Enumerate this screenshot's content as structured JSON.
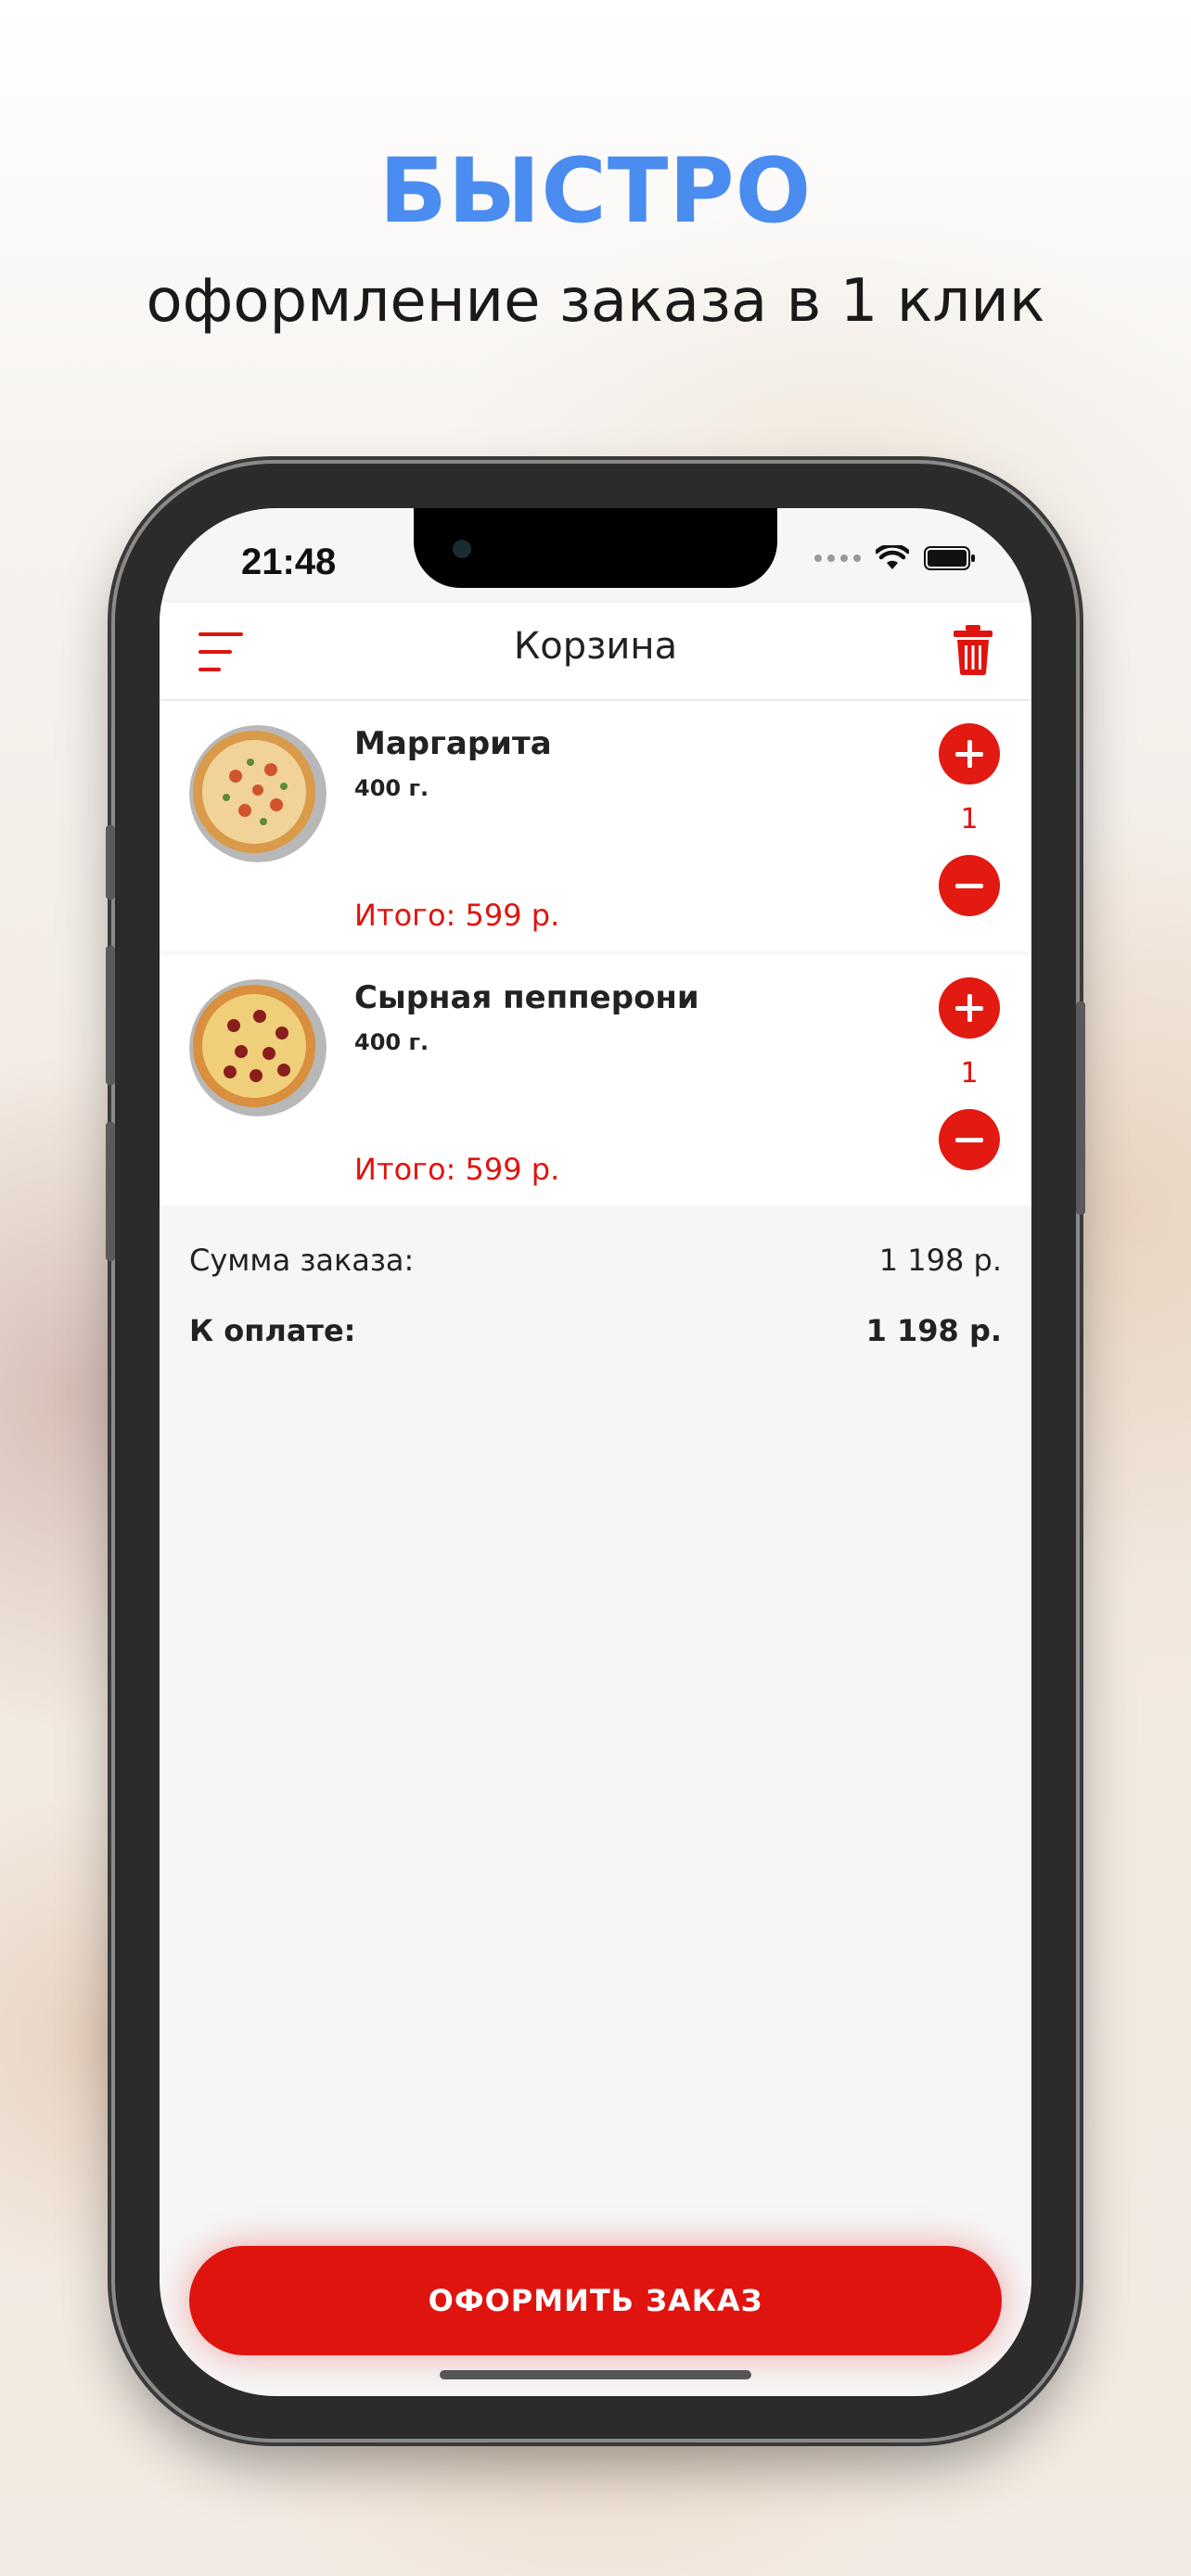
{
  "promo": {
    "headline": "БЫСТРО",
    "subline": "оформление заказа в 1 клик"
  },
  "status_bar": {
    "time": "21:48"
  },
  "header": {
    "title": "Корзина",
    "menu_icon": "menu-icon",
    "trash_icon": "trash-icon"
  },
  "items": [
    {
      "name": "Маргарита",
      "weight": "400 г.",
      "total": "Итого: 599 р.",
      "quantity": "1"
    },
    {
      "name": "Сырная пепперони",
      "weight": "400 г.",
      "total": "Итого: 599 р.",
      "quantity": "1"
    }
  ],
  "summary": {
    "order_sum_label": "Сумма заказа:",
    "order_sum_value": "1 198 р.",
    "to_pay_label": "К оплате:",
    "to_pay_value": "1 198 р."
  },
  "checkout_label": "ОФОРМИТЬ ЗАКАЗ",
  "colors": {
    "accent": "#e0140f",
    "headline": "#4a8cf0"
  }
}
